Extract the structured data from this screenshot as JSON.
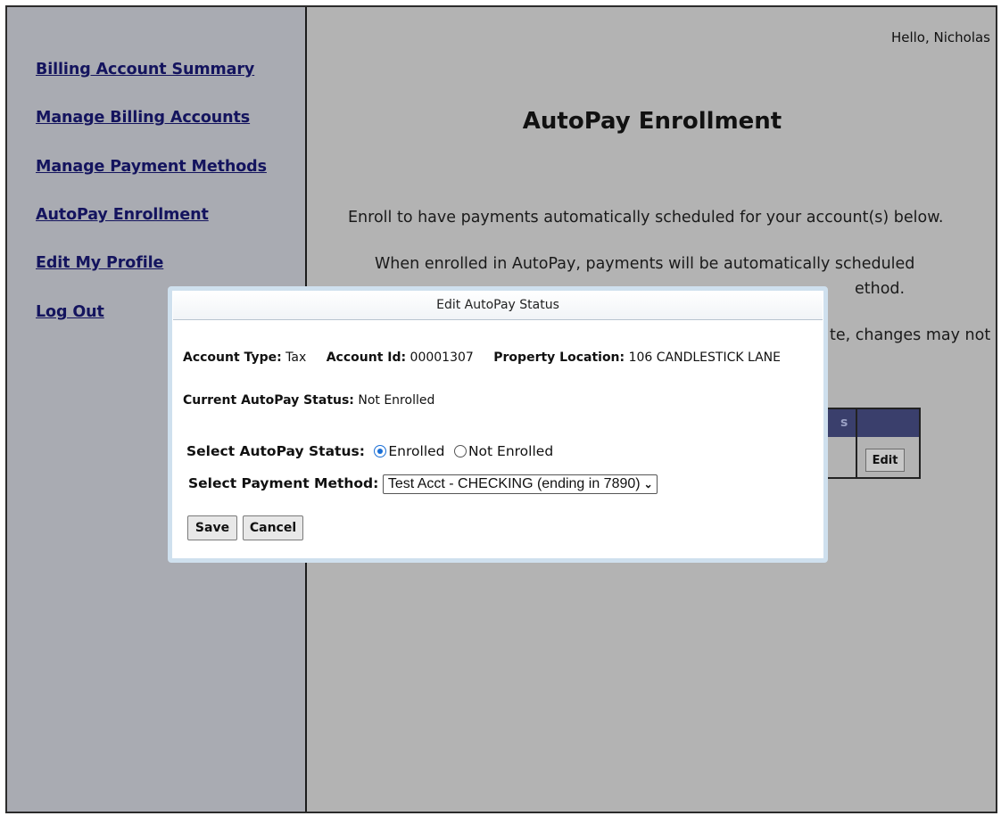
{
  "sidebar": {
    "items": [
      {
        "label": "Billing Account Summary"
      },
      {
        "label": "Manage Billing Accounts"
      },
      {
        "label": "Manage Payment Methods"
      },
      {
        "label": "AutoPay Enrollment"
      },
      {
        "label": "Edit My Profile"
      },
      {
        "label": "Log Out"
      }
    ]
  },
  "header": {
    "greeting": "Hello, Nicholas"
  },
  "main": {
    "title": "AutoPay Enrollment",
    "intro": "Enroll to have payments automatically scheduled for your account(s) below.",
    "note_line1": "When enrolled in AutoPay, payments will be automatically scheduled",
    "note_line2_partial": "ethod.",
    "note_line3_partial": "te, changes may not",
    "table": {
      "header_partial": "s",
      "edit_label": "Edit"
    }
  },
  "modal": {
    "title": "Edit AutoPay Status",
    "account_type_label": "Account Type:",
    "account_type": "Tax",
    "account_id_label": "Account Id:",
    "account_id": "00001307",
    "property_location_label": "Property Location:",
    "property_location": "106 CANDLESTICK LANE",
    "current_status_label": "Current AutoPay Status:",
    "current_status": "Not Enrolled",
    "select_status_label": "Select AutoPay Status:",
    "status_options": [
      {
        "label": "Enrolled",
        "checked": true
      },
      {
        "label": "Not Enrolled",
        "checked": false
      }
    ],
    "select_method_label": "Select Payment Method:",
    "payment_method_selected": "Test Acct - CHECKING (ending in 7890)",
    "save_label": "Save",
    "cancel_label": "Cancel"
  }
}
